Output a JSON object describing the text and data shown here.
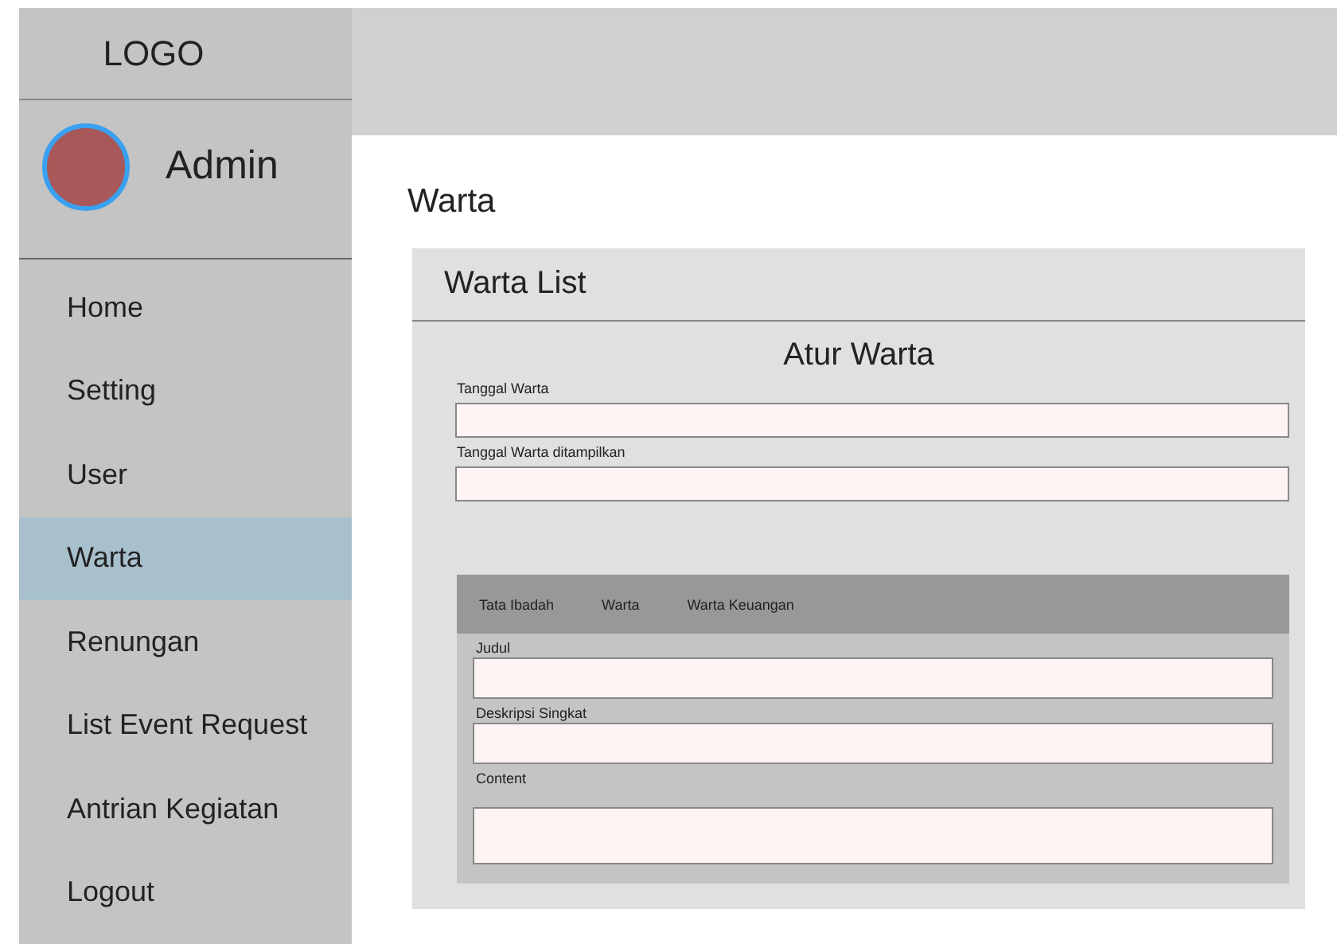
{
  "sidebar": {
    "logo": "LOGO",
    "user": {
      "name": "Admin"
    },
    "items": [
      {
        "label": "Home",
        "selected": false
      },
      {
        "label": "Setting",
        "selected": false
      },
      {
        "label": "User",
        "selected": false
      },
      {
        "label": "Warta",
        "selected": true
      },
      {
        "label": "Renungan",
        "selected": false
      },
      {
        "label": "List Event Request",
        "selected": false
      },
      {
        "label": "Antrian Kegiatan",
        "selected": false
      },
      {
        "label": "Logout",
        "selected": false
      }
    ]
  },
  "page": {
    "title": "Warta"
  },
  "card": {
    "title": "Warta List",
    "form_title": "Atur Warta",
    "fields": [
      {
        "label": "Tanggal Warta"
      },
      {
        "label": "Tanggal Warta ditampilkan"
      }
    ],
    "tabs": [
      {
        "label": "Tata Ibadah"
      },
      {
        "label": "Warta"
      },
      {
        "label": "Warta Keuangan"
      }
    ],
    "tab_fields": [
      {
        "label": "Judul",
        "kind": "input"
      },
      {
        "label": "Deskripsi Singkat",
        "kind": "input"
      },
      {
        "label": "Content",
        "kind": "textarea"
      }
    ]
  }
}
